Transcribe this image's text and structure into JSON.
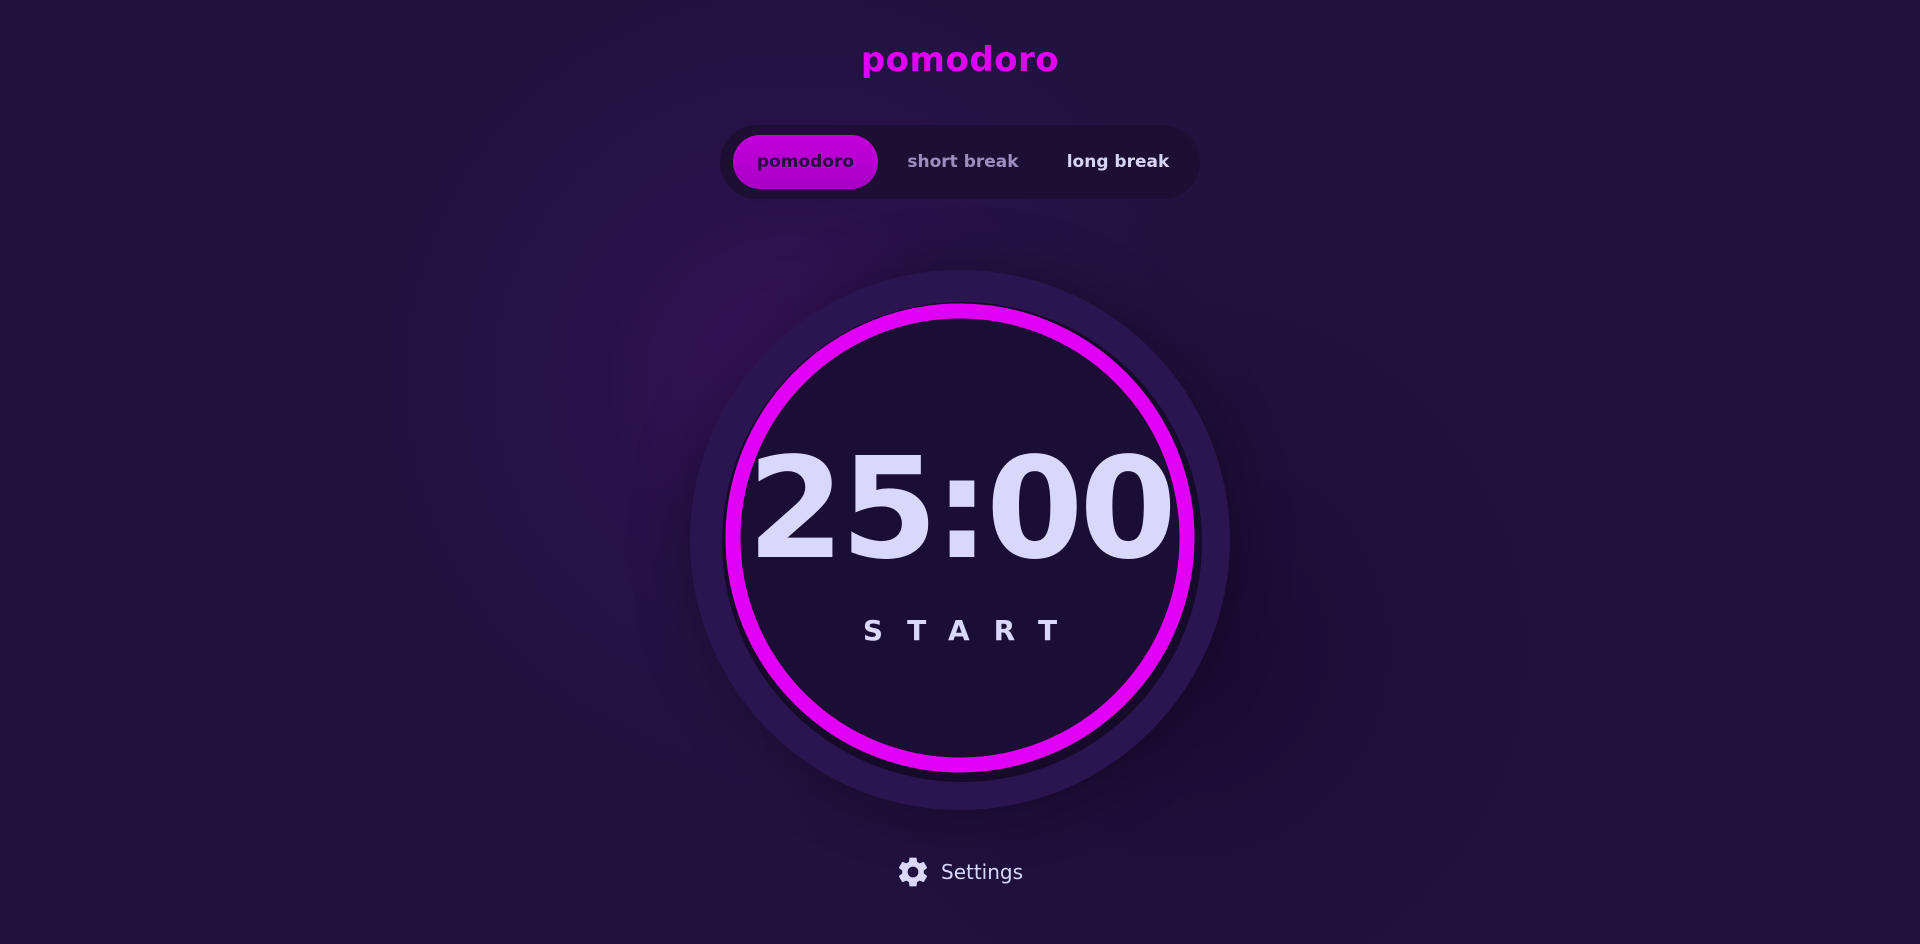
{
  "app": {
    "title": "pomodoro"
  },
  "modes": {
    "tabs": [
      {
        "label": "pomodoro",
        "active": true
      },
      {
        "label": "short break",
        "active": false
      },
      {
        "label": "long break",
        "active": false
      }
    ]
  },
  "timer": {
    "time": "25:00",
    "action_label": "START",
    "progress": 1.0
  },
  "settings": {
    "label": "Settings",
    "icon": "gear-icon"
  },
  "colors": {
    "accent": "#e100f5",
    "background": "#221240",
    "text": "#d9d8fb"
  }
}
